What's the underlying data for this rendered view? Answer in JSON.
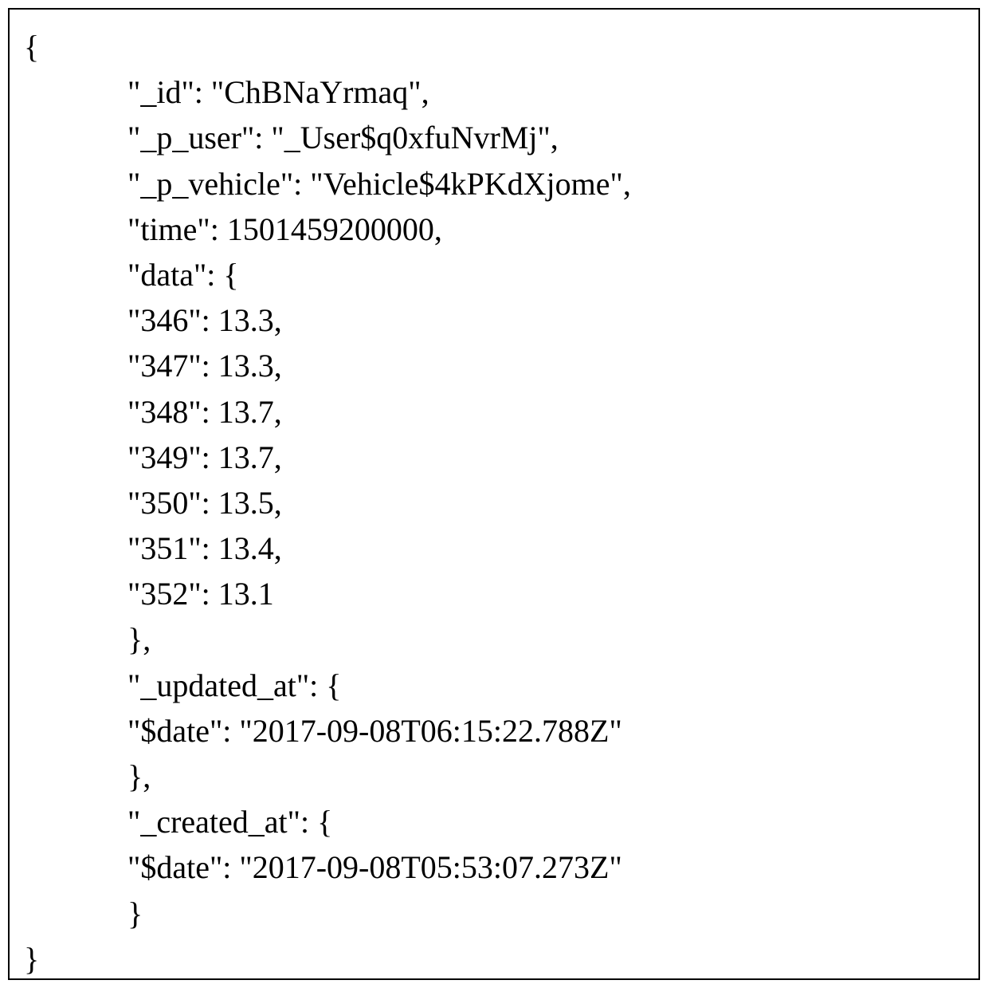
{
  "code": {
    "open_brace": "{",
    "id_line": "\"_id\": \"ChBNaYrmaq\",",
    "p_user_line": "\"_p_user\": \"_User$q0xfuNvrMj\",",
    "p_vehicle_line": "\"_p_vehicle\": \"Vehicle$4kPKdXjome\",",
    "time_line": "\"time\": 1501459200000,",
    "data_open": "\"data\": {",
    "d346": "\"346\": 13.3,",
    "d347": "\"347\": 13.3,",
    "d348": "\"348\": 13.7,",
    "d349": "\"349\": 13.7,",
    "d350": "\"350\": 13.5,",
    "d351": "\"351\": 13.4,",
    "d352": "\"352\": 13.1",
    "data_close": "},",
    "updated_open": "\"_updated_at\": {",
    "updated_date": "\"$date\": \"2017-09-08T06:15:22.788Z\"",
    "updated_close": "},",
    "created_open": "\"_created_at\": {",
    "created_date": "\"$date\": \"2017-09-08T05:53:07.273Z\"",
    "created_close": "}",
    "close_brace": "}"
  }
}
